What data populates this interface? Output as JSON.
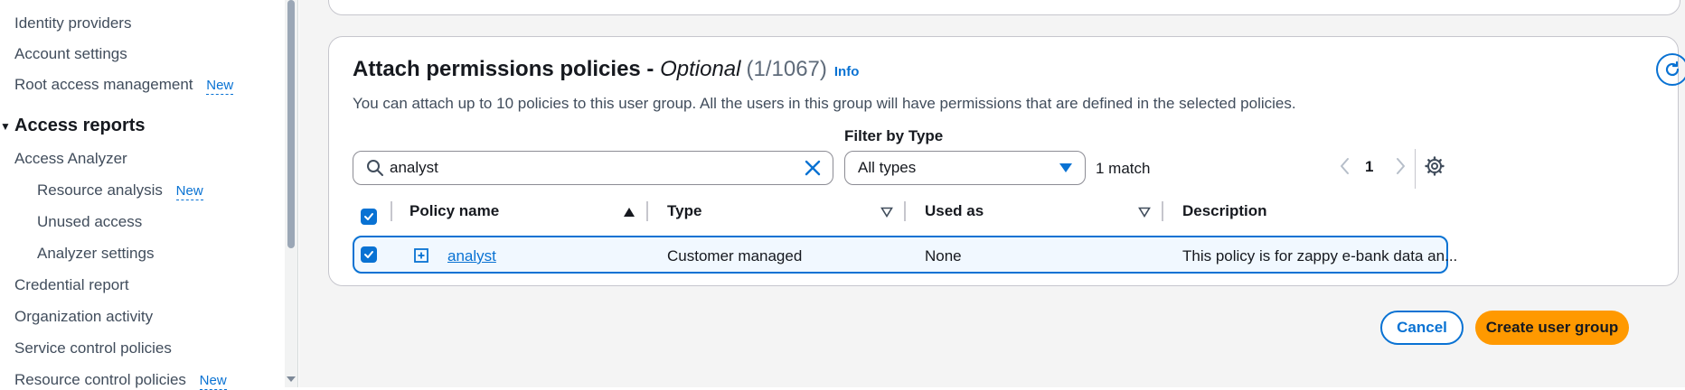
{
  "sidebar": {
    "items": [
      {
        "label": "Identity providers"
      },
      {
        "label": "Account settings"
      },
      {
        "label": "Root access management",
        "badge": "New"
      },
      {
        "label": "Access reports"
      },
      {
        "label": "Access Analyzer"
      },
      {
        "label": "Resource analysis",
        "badge": "New"
      },
      {
        "label": "Unused access"
      },
      {
        "label": "Analyzer settings"
      },
      {
        "label": "Credential report"
      },
      {
        "label": "Organization activity"
      },
      {
        "label": "Service control policies"
      },
      {
        "label": "Resource control policies",
        "badge": "New"
      }
    ]
  },
  "policies": {
    "title": "Attach permissions policies - ",
    "title_optional": "Optional",
    "count": "(1/1067)",
    "info": "Info",
    "description": "You can attach up to 10 policies to this user group. All the users in this group will have permissions that are defined in the selected policies.",
    "search_value": "analyst",
    "filter_label": "Filter by Type",
    "filter_value": "All types",
    "match_text": "1 match",
    "page": "1",
    "columns": {
      "name": "Policy name",
      "type": "Type",
      "used_as": "Used as",
      "description": "Description"
    },
    "rows": [
      {
        "name": "analyst",
        "type": "Customer managed",
        "used_as": "None",
        "description": "This policy is for zappy e-bank data an..."
      }
    ]
  },
  "footer": {
    "cancel": "Cancel",
    "create": "Create user group"
  },
  "colors": {
    "accent": "#0972d3",
    "primary_button": "#ff9900",
    "selected_row_bg": "#f1f8ff"
  }
}
